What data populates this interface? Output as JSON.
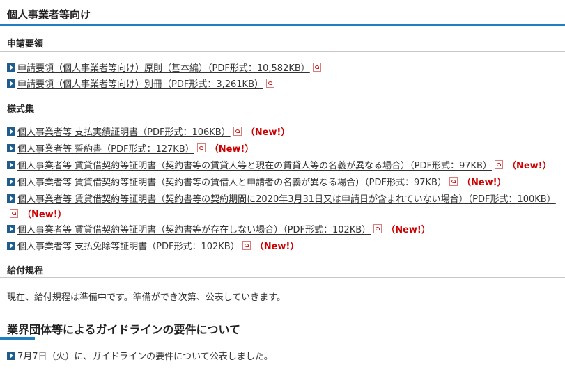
{
  "section1": {
    "title": "個人事業者等向け",
    "rule_color": "#1f7fc0"
  },
  "application": {
    "heading": "申請要領",
    "items": [
      "申請要領（個人事業者等向け）原則（基本編）（PDF形式：10,582KB）",
      "申請要領（個人事業者等向け）別冊（PDF形式：3,261KB）"
    ]
  },
  "forms": {
    "heading": "様式集",
    "new_label": "（New!）",
    "items": [
      "個人事業者等 支払実績証明書（PDF形式：106KB）",
      "個人事業者等 誓約書（PDF形式：127KB）",
      "個人事業者等 賃貸借契約等証明書（契約書等の賃貸人等と現在の賃貸人等の名義が異なる場合）（PDF形式：97KB）",
      "個人事業者等 賃貸借契約等証明書（契約書等の賃借人と申請者の名義が異なる場合）（PDF形式：97KB）",
      "個人事業者等 賃貸借契約等証明書（契約書等の契約期間に2020年3月31日又は申請日が含まれていない場合）（PDF形式：100KB）",
      "個人事業者等 賃貸借契約等証明書（契約書等が存在しない場合）（PDF形式：102KB）",
      "個人事業者等 支払免除等証明書（PDF形式：102KB）"
    ]
  },
  "benefits": {
    "heading": "給付規程",
    "text": "現在、給付規程は準備中です。準備ができ次第、公表していきます。"
  },
  "section2": {
    "title": "業界団体等によるガイドラインの要件について",
    "rule_color": "#1f7fc0",
    "items": [
      "7月7日（火）に、ガイドラインの要件について公表しました。"
    ]
  }
}
